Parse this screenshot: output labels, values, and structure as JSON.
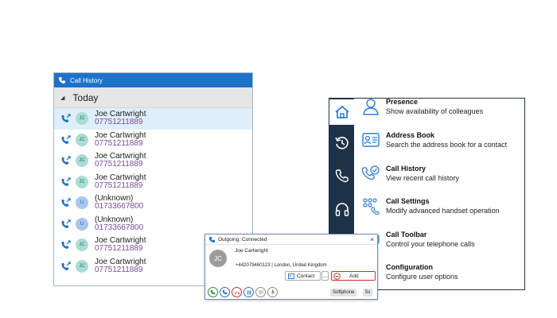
{
  "call_history": {
    "title": "Call History",
    "section": "Today",
    "items": [
      {
        "initials": "JC",
        "name": "Joe Cartwright",
        "number": "07751211889"
      },
      {
        "initials": "JC",
        "name": "Joe Cartwright",
        "number": "07751211889"
      },
      {
        "initials": "JC",
        "name": "Joe Cartwright",
        "number": "07751211889"
      },
      {
        "initials": "JC",
        "name": "Joe Cartwright",
        "number": "07751211889"
      },
      {
        "initials": "U",
        "name": "(Unknown)",
        "number": "01733667800"
      },
      {
        "initials": "U",
        "name": "(Unknown)",
        "number": "01733667800"
      },
      {
        "initials": "JC",
        "name": "Joe Cartwright",
        "number": "07751211889"
      },
      {
        "initials": "JC",
        "name": "Joe Cartwright",
        "number": "07751211889"
      }
    ]
  },
  "outgoing_call": {
    "title": "Outgoing: Connected",
    "close": "×",
    "initials": "JC",
    "name": "Joe Cartwright",
    "detail": "+442079460123 | London, United Kingdom",
    "contact_label": "Contact",
    "more_label": "...",
    "add_label": "Add",
    "mode_label": "Softphone",
    "timer": "5s"
  },
  "home_panel": {
    "items": [
      {
        "title": "Presence",
        "desc": "Show availability of colleagues",
        "icon": "person-icon"
      },
      {
        "title": "Address Book",
        "desc": "Search the address book for a contact",
        "icon": "address-card-icon"
      },
      {
        "title": "Call History",
        "desc": "View recent call history",
        "icon": "phone-check-icon"
      },
      {
        "title": "Call Settings",
        "desc": "Modify advanced handset operation",
        "icon": "keypad-icon"
      },
      {
        "title": "Call Toolbar",
        "desc": "Control your telephone calls",
        "icon": "toolbar-icon"
      },
      {
        "title": "Configuration",
        "desc": "Configure user options",
        "icon": "gear-icon"
      }
    ],
    "rail": [
      "home-icon",
      "history-icon",
      "phone-icon",
      "headset-icon"
    ]
  },
  "colors": {
    "titlebar_blue": "#1e73c9",
    "rail_navy": "#1f3348",
    "accent_purple": "#7a4a98",
    "avatar_teal": "#a9ddd6",
    "avatar_blue": "#a8c6f0",
    "selected_row": "#dfeefb",
    "danger_red": "#cc2c2c",
    "ok_green": "#2f8a3a"
  }
}
